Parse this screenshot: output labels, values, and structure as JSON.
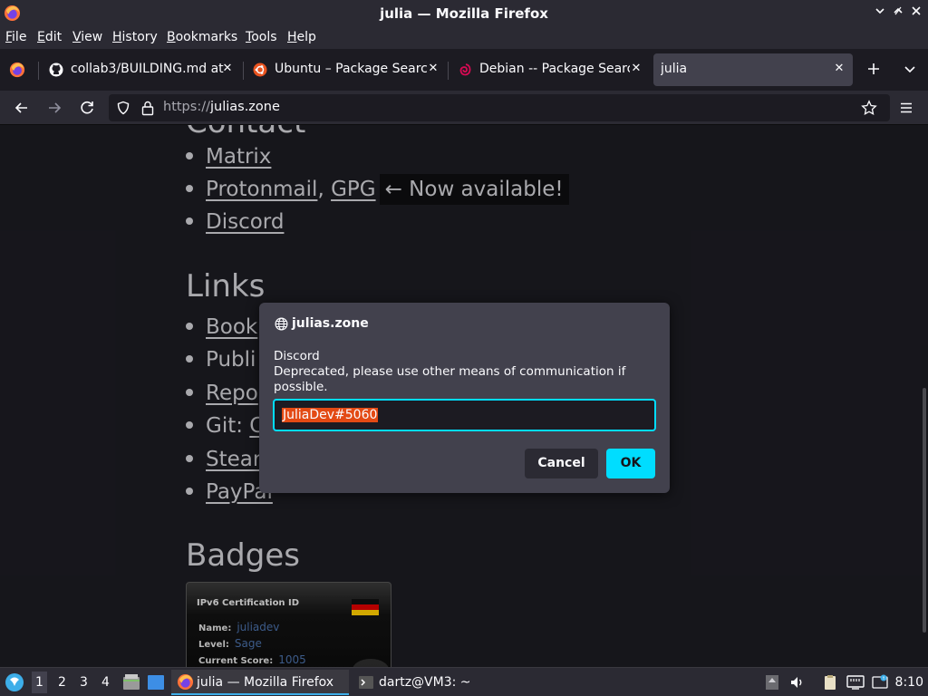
{
  "window": {
    "title": "julia — Mozilla Firefox"
  },
  "menu": {
    "items": [
      {
        "label": "File",
        "key": "F",
        "rest": "ile"
      },
      {
        "label": "Edit",
        "key": "E",
        "rest": "dit"
      },
      {
        "label": "View",
        "key": "V",
        "rest": "iew"
      },
      {
        "label": "History",
        "key": "H",
        "rest": "istory"
      },
      {
        "label": "Bookmarks",
        "key": "B",
        "rest": "ookmarks"
      },
      {
        "label": "Tools",
        "key": "T",
        "rest": "ools"
      },
      {
        "label": "Help",
        "key": "H",
        "rest": "elp"
      }
    ]
  },
  "tabs": [
    {
      "label": "collab3/BUILDING.md at",
      "favicon": "github-icon"
    },
    {
      "label": "Ubuntu – Package Search",
      "favicon": "ubuntu-icon"
    },
    {
      "label": "Debian -- Package Search",
      "favicon": "debian-icon"
    },
    {
      "label": "julia",
      "favicon": "none"
    }
  ],
  "urlbar": {
    "scheme": "https://",
    "host": "julias.zone"
  },
  "page": {
    "contact_items": [
      {
        "link": "Matrix"
      },
      {
        "link1": "Protonmail",
        "sep": ",",
        "link2": "GPG",
        "note": "← Now available!"
      },
      {
        "link": "Discord"
      }
    ],
    "links_heading": "Links",
    "links_items": [
      "Book",
      "Publi",
      "Repo",
      "Git: C",
      "Stear",
      "PayPal"
    ],
    "links_prefix": "Git: ",
    "links_git_link": "C",
    "badges_heading": "Badges",
    "badge": {
      "title": "IPv6 Certification ID",
      "name_label": "Name:",
      "name_value": "juliadev",
      "level_label": "Level:",
      "level_value": "Sage",
      "score_label": "Current Score:",
      "score_value": "1005"
    }
  },
  "dialog": {
    "site": "julias.zone",
    "message_title": "Discord",
    "message_body": "Deprecated, please use other means of communication if possible.",
    "input_value": "JuliaDev#5060",
    "cancel_label": "Cancel",
    "ok_label": "OK"
  },
  "taskbar": {
    "workspaces": [
      "1",
      "2",
      "3",
      "4"
    ],
    "tasks": [
      {
        "label": "julia — Mozilla Firefox",
        "icon": "firefox-icon"
      },
      {
        "label": "dartz@VM3: ~",
        "icon": "terminal-icon"
      }
    ],
    "clock": "8:10"
  },
  "colors": {
    "accent": "#00ddff",
    "selection": "#e34a14"
  }
}
